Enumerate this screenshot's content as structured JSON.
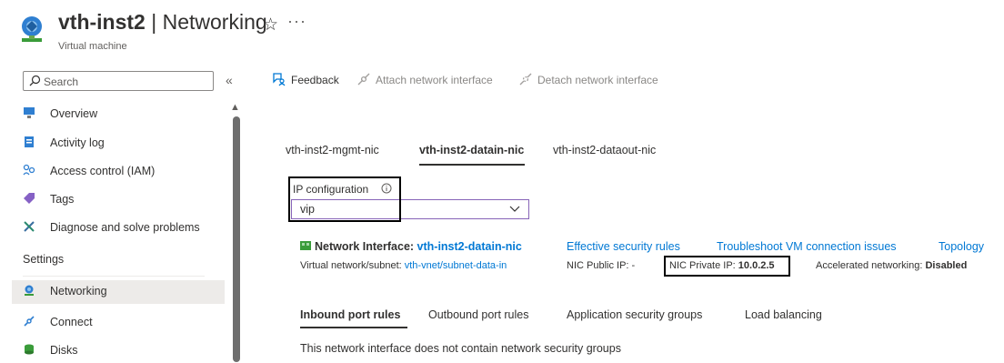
{
  "header": {
    "resource_name": "vth-inst2",
    "separator": " | ",
    "blade_title": "Networking",
    "subtitle": "Virtual machine",
    "favorite_glyph": "☆",
    "more_glyph": "···"
  },
  "search": {
    "placeholder": "Search",
    "collapse_glyph": "«"
  },
  "sidebar": {
    "items": [
      {
        "label": "Overview",
        "icon": "monitor-icon"
      },
      {
        "label": "Activity log",
        "icon": "activity-log-icon"
      },
      {
        "label": "Access control (IAM)",
        "icon": "people-icon"
      },
      {
        "label": "Tags",
        "icon": "tag-icon"
      },
      {
        "label": "Diagnose and solve problems",
        "icon": "wrench-icon"
      }
    ],
    "section_settings": "Settings",
    "settings_items": [
      {
        "label": "Networking",
        "icon": "networking-icon",
        "active": true
      },
      {
        "label": "Connect",
        "icon": "connect-icon"
      },
      {
        "label": "Disks",
        "icon": "disks-icon"
      }
    ]
  },
  "toolbar": {
    "feedback": "Feedback",
    "attach": "Attach network interface",
    "detach": "Detach network interface"
  },
  "nic_tabs": [
    "vth-inst2-mgmt-nic",
    "vth-inst2-datain-nic",
    "vth-inst2-dataout-nic"
  ],
  "ip_config": {
    "label": "IP configuration",
    "value": "vip"
  },
  "nic": {
    "title_prefix": "Network Interface: ",
    "name": "vth-inst2-datain-nic",
    "links": [
      "Effective security rules",
      "Troubleshoot VM connection issues",
      "Topology"
    ],
    "vnet_label": "Virtual network/subnet: ",
    "vnet_value": "vth-vnet/subnet-data-in",
    "public_ip_label": "NIC Public IP: ",
    "public_ip_value": "-",
    "private_ip_label": "NIC Private IP: ",
    "private_ip_value": "10.0.2.5",
    "accel_label": "Accelerated networking: ",
    "accel_value": "Disabled"
  },
  "rule_tabs": [
    "Inbound port rules",
    "Outbound port rules",
    "Application security groups",
    "Load balancing"
  ],
  "empty_message": "This network interface does not contain network security groups",
  "colors": {
    "accent": "#0078d4",
    "select_border": "#8764b8",
    "active_bg": "#edebe9"
  }
}
